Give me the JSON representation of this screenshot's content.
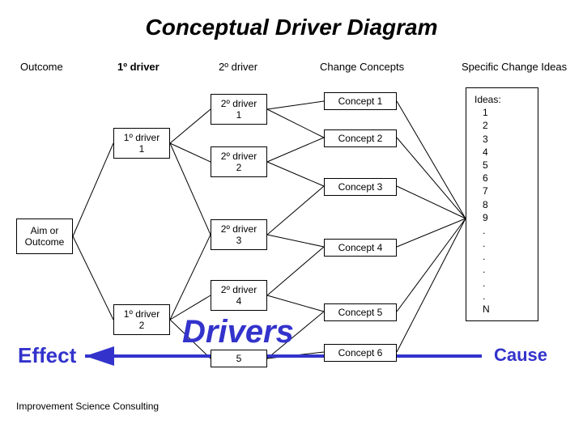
{
  "title": "Conceptual Driver Diagram",
  "headers": {
    "outcome": "Outcome",
    "primary": "1º driver",
    "secondary": "2º driver",
    "concepts": "Change Concepts",
    "ideas": "Specific Change Ideas"
  },
  "nodes": {
    "aim": "Aim or\nOutcome",
    "p1": "1º driver\n1",
    "p2": "1º driver\n2",
    "s1": "2º driver\n1",
    "s2": "2º driver\n2",
    "s3": "2º driver\n3",
    "s4": "2º driver\n4",
    "s5": "5",
    "c1": "Concept 1",
    "c2": "Concept 2",
    "c3": "Concept 3",
    "c4": "Concept 4",
    "c5": "Concept 5",
    "c6": "Concept 6"
  },
  "ideas": {
    "header": "Ideas:",
    "lines": [
      "1",
      "2",
      "3",
      "4",
      "5",
      "6",
      "7",
      "8",
      "9",
      ".",
      ".",
      ".",
      ".",
      ".",
      ".",
      "N"
    ]
  },
  "overlays": {
    "drivers": "Drivers",
    "effect": "Effect",
    "cause": "Cause"
  },
  "footer": "Improvement Science Consulting",
  "colors": {
    "accent": "#3333cc",
    "arrow": "#3333cc"
  }
}
